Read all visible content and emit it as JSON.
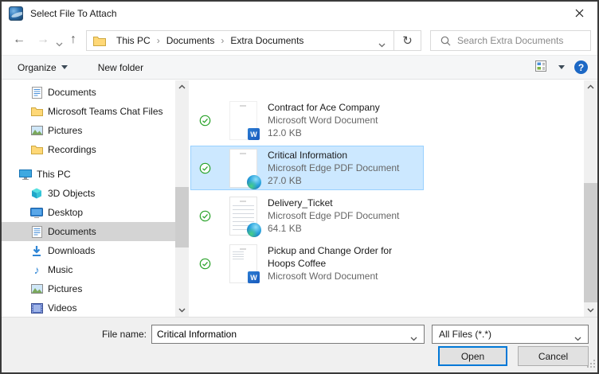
{
  "window": {
    "title": "Select File To Attach"
  },
  "nav": {
    "back_icon": "←",
    "forward_icon": "→",
    "up_icon": "↑",
    "refresh_icon": "↻",
    "crumbs": [
      "This PC",
      "Documents",
      "Extra Documents"
    ],
    "crumb_sep": "›",
    "search_placeholder": "Search Extra Documents"
  },
  "toolbar": {
    "organize_label": "Organize",
    "new_folder_label": "New folder",
    "help_label": "?"
  },
  "sidebar": {
    "quick": [
      {
        "label": "Documents",
        "icon": "document-icon"
      },
      {
        "label": "Microsoft Teams Chat Files",
        "icon": "folder-icon"
      },
      {
        "label": "Pictures",
        "icon": "picture-icon"
      },
      {
        "label": "Recordings",
        "icon": "folder-icon"
      }
    ],
    "this_pc_label": "This PC",
    "pc": [
      {
        "label": "3D Objects",
        "icon": "cube-icon"
      },
      {
        "label": "Desktop",
        "icon": "desktop-icon"
      },
      {
        "label": "Documents",
        "icon": "document-icon",
        "selected": true
      },
      {
        "label": "Downloads",
        "icon": "download-icon"
      },
      {
        "label": "Music",
        "icon": "music-icon",
        "glyph": "♪"
      },
      {
        "label": "Pictures",
        "icon": "picture-icon"
      },
      {
        "label": "Videos",
        "icon": "video-icon"
      }
    ]
  },
  "files": [
    {
      "name": "Contract for Ace Company",
      "type": "Microsoft Word Document",
      "size": "12.0 KB",
      "app": "word",
      "selected": false
    },
    {
      "name": "Critical Information",
      "type": "Microsoft Edge PDF Document",
      "size": "27.0 KB",
      "app": "edge",
      "selected": true
    },
    {
      "name": "Delivery_Ticket",
      "type": "Microsoft Edge PDF Document",
      "size": "64.1 KB",
      "app": "edge",
      "selected": false
    },
    {
      "name": "Pickup and Change Order for Hoops Coffee",
      "type": "Microsoft Word Document",
      "size": "",
      "app": "word",
      "selected": false
    }
  ],
  "icons": {
    "word_letter": "W"
  },
  "footer": {
    "file_name_label": "File name:",
    "file_name_value": "Critical Information",
    "file_type_value": "All Files (*.*)",
    "open_label": "Open",
    "cancel_label": "Cancel"
  },
  "colors": {
    "accent": "#0078d7",
    "selection_bg": "#cce8ff",
    "selection_border": "#99d1ff",
    "sidebar_selected_bg": "#d4d4d4",
    "check_green": "#27a127",
    "help_blue": "#1c68c5",
    "word_blue": "#185abd"
  }
}
